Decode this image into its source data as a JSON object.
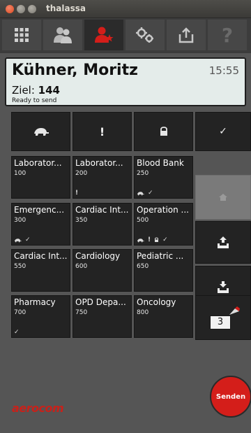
{
  "window": {
    "title": "thalassa"
  },
  "header": {
    "patient_name": "Kühner, Moritz",
    "time": "15:55",
    "target_label": "Ziel: ",
    "target_value": "144",
    "status": "Ready to send"
  },
  "actions": {
    "icons": [
      "turtle-icon",
      "priority-icon",
      "lock-icon",
      "check-icon"
    ],
    "priority_glyph": "!",
    "check_glyph": "✓"
  },
  "destinations": [
    {
      "name": "Laborator...",
      "code": "100",
      "flags": []
    },
    {
      "name": "Laborator...",
      "code": "200",
      "flags": [
        "!"
      ]
    },
    {
      "name": "Blood Bank",
      "code": "250",
      "flags": [
        "turtle",
        "✓"
      ]
    },
    {
      "name": "Emergenc...",
      "code": "300",
      "flags": [
        "turtle",
        "✓"
      ]
    },
    {
      "name": "Cardiac Int...",
      "code": "350",
      "flags": []
    },
    {
      "name": "Operation ...",
      "code": "500",
      "flags": [
        "turtle",
        "!",
        "lock",
        "✓"
      ]
    },
    {
      "name": "Cardiac Int...",
      "code": "550",
      "flags": []
    },
    {
      "name": "Cardiology",
      "code": "600",
      "flags": []
    },
    {
      "name": "Pediatric ...",
      "code": "650",
      "flags": []
    },
    {
      "name": "Pharmacy",
      "code": "700",
      "flags": [
        "✓"
      ]
    },
    {
      "name": "OPD Depa...",
      "code": "750",
      "flags": []
    },
    {
      "name": "Oncology",
      "code": "800",
      "flags": []
    }
  ],
  "side": {
    "counter": "3"
  },
  "brand": {
    "logo": "aerocom",
    "send_label": "Senden"
  },
  "toolbar": {
    "buttons": [
      "grid-icon",
      "contacts-icon",
      "add-contact-icon",
      "settings-icon",
      "export-icon",
      "help-icon"
    ],
    "help_glyph": "?"
  },
  "colors": {
    "brand_red": "#d41e1a",
    "header_bg": "#e4ecea",
    "tile_bg": "#232323"
  }
}
